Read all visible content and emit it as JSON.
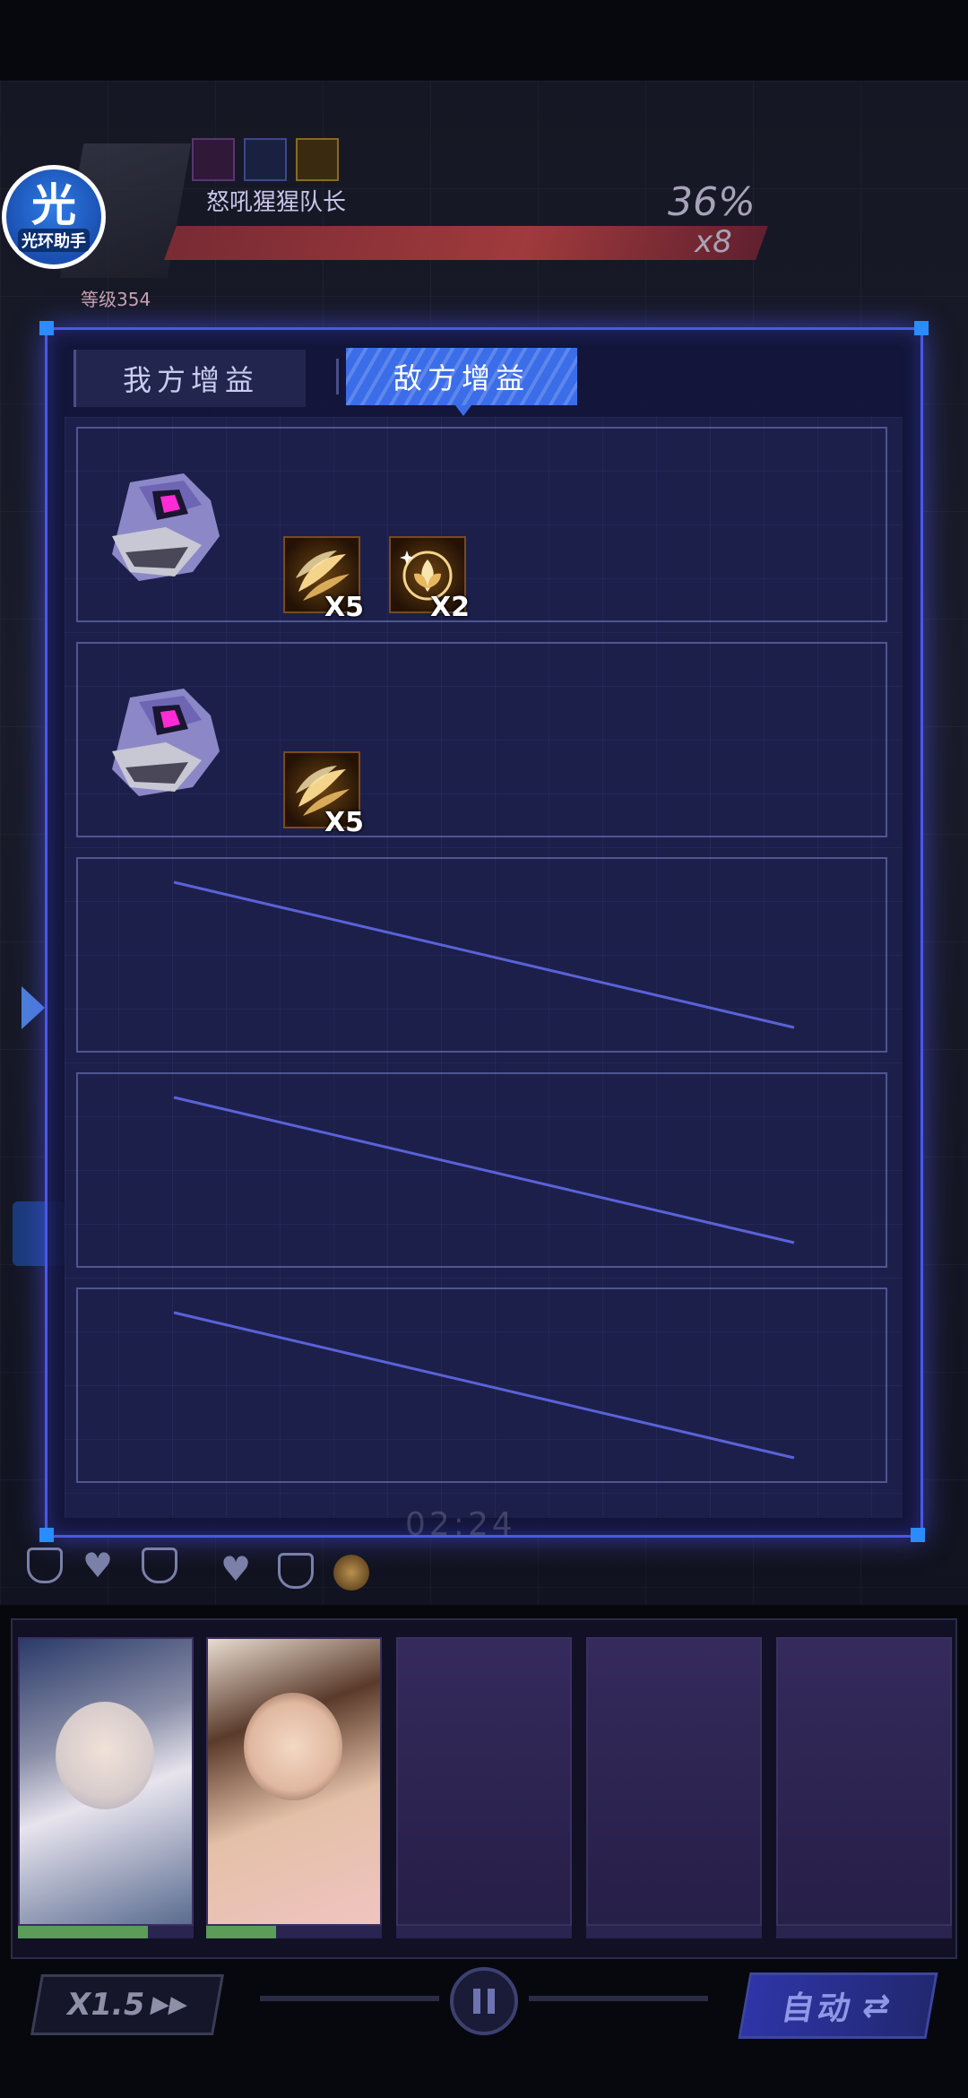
{
  "helper": {
    "glyph": "光",
    "label": "光环助手"
  },
  "boss": {
    "name": "怒吼猩猩队长",
    "hp_percent": "36%",
    "bar_count": "x8",
    "level": "等级354",
    "hp_fraction": 0.36
  },
  "buff_panel": {
    "tabs": [
      {
        "label": "我方增益",
        "selected": false
      },
      {
        "label": "敌方增益",
        "selected": true
      }
    ],
    "rows": [
      {
        "enemy_icon": "robot-enemy-icon",
        "buffs": [
          {
            "icon": "golden-feather-buff-icon",
            "count": "X5"
          },
          {
            "icon": "golden-leaf-buff-icon",
            "count": "X2"
          }
        ]
      },
      {
        "enemy_icon": "robot-enemy-icon",
        "buffs": [
          {
            "icon": "golden-feather-buff-icon",
            "count": "X5"
          }
        ]
      },
      {
        "empty": true
      },
      {
        "empty": true
      },
      {
        "empty": true
      }
    ]
  },
  "battle": {
    "timer": "02:24"
  },
  "team": {
    "cards": [
      {
        "portrait": "white-haired-girl-portrait",
        "hp_fraction": 0.74
      },
      {
        "portrait": "brown-haired-bunny-girl-portrait",
        "hp_fraction": 0.4
      },
      {
        "portrait": "empty-slot"
      },
      {
        "portrait": "empty-slot"
      },
      {
        "portrait": "empty-slot"
      }
    ]
  },
  "controls": {
    "speed_label": "X1.5",
    "speed_arrows": "▶▶",
    "auto_label": "自动",
    "auto_icon": "⇄"
  },
  "colors": {
    "accent": "#3b6de8",
    "modal_border": "#4a58e6",
    "hp_green": "#5a9c58",
    "boss_bar": "#b84040"
  }
}
